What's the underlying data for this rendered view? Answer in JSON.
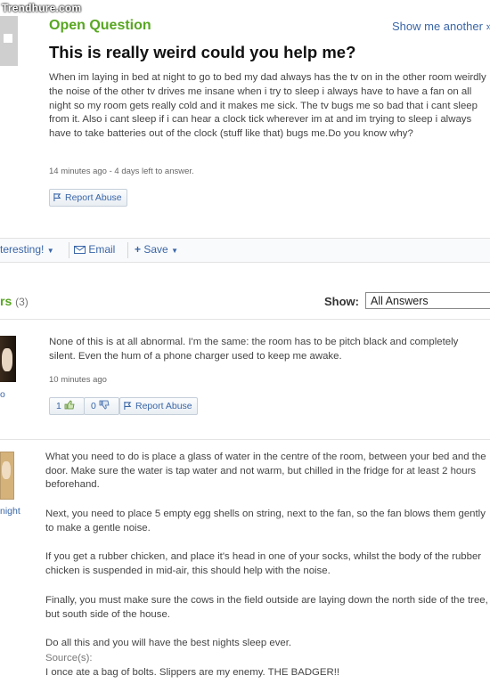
{
  "watermark": "Trendhure.com",
  "question": {
    "status": "Open Question",
    "show_another": "Show me another »",
    "title": "This is really weird could you help me?",
    "body": "When im laying in bed at night to go to bed my dad always has the tv on in the other room weirdly the noise of the other tv drives me insane when i try to sleep i always have to have a fan on all night so my room gets really cold and it makes me sick. The tv bugs me so bad that i cant sleep from it. Also i cant sleep if i can hear a clock tick wherever im at and im trying to sleep i always have to take batteries out of the clock (stuff like that) bugs me.Do you know why?",
    "meta": "14 minutes ago - 4 days left to answer.",
    "report_label": "Report Abuse"
  },
  "toolbar": {
    "interesting_label": "teresting!",
    "email_label": "Email",
    "save_label": "Save"
  },
  "answers_header": {
    "label_fragment": "rs",
    "count": "(3)",
    "show_label": "Show:",
    "show_selected": "All Answers"
  },
  "answers": [
    {
      "user_fragment": "o",
      "text": "None of this is at all abnormal. I'm the same: the room has to be pitch black and completely silent. Even the hum of a phone charger used to keep me awake.",
      "time": "10 minutes ago",
      "thumbs_up": "1",
      "thumbs_down": "0",
      "report_label": "Report Abuse"
    },
    {
      "user_fragment": "night",
      "paragraphs": [
        "What you need to do is place a glass of water in the centre of the room, between your bed and the door. Make sure the water is tap water and not warm, but chilled in the fridge for at least 2 hours beforehand.",
        "Next, you need to place 5 empty egg shells on string, next to the fan, so the fan blows them gently to make a gentle noise.",
        "If you get a rubber chicken, and place it's head in one of your socks, whilst the body of the rubber chicken is suspended in mid-air, this should help with the noise.",
        "Finally, you must make sure the cows in the field outside are laying down the north side of the tree, but south side of the house.",
        "Do all this and you will have the best nights sleep ever."
      ],
      "source_label": "Source(s):",
      "source": "I once ate a bag of bolts. Slippers are my enemy. THE BADGER!!"
    }
  ]
}
